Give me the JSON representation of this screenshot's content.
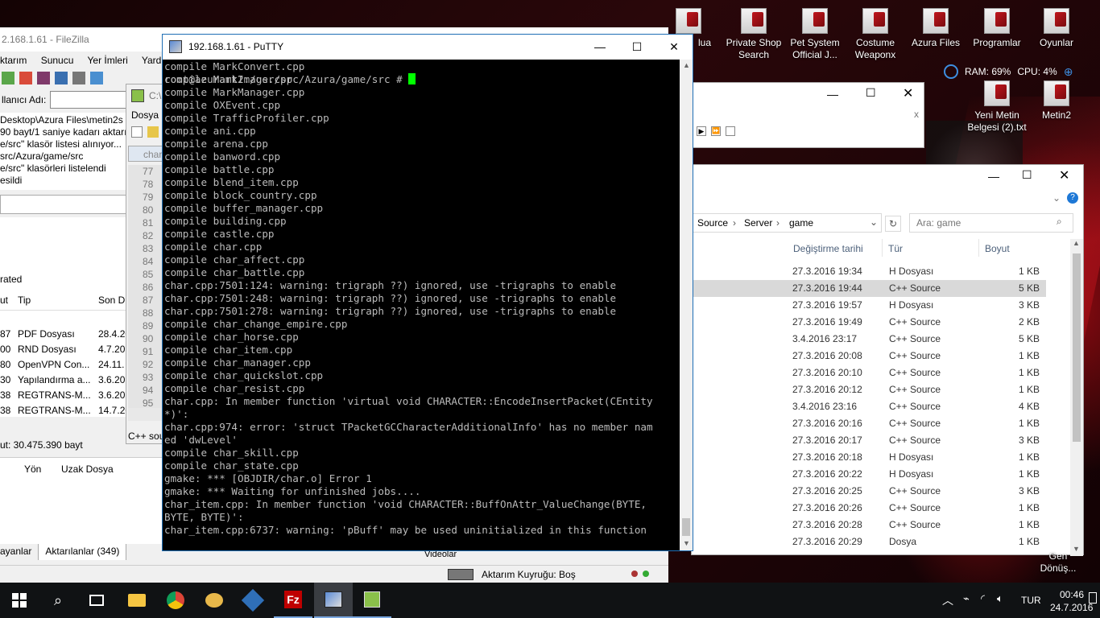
{
  "desktop_icons": [
    {
      "label": "Private Shop Search"
    },
    {
      "label": "Pet System Official J..."
    },
    {
      "label": "Costume Weaponx"
    },
    {
      "label": "Azura Files"
    },
    {
      "label": "Programlar"
    },
    {
      "label": "Oyunlar"
    },
    {
      "label": "Yeni Metin Belgesi (2).txt"
    },
    {
      "label": "Metin2"
    },
    {
      "label": "lua"
    }
  ],
  "resource_meter": {
    "ram": "RAM: 69%",
    "cpu": "CPU: 4%"
  },
  "filezilla": {
    "title": "2.168.1.61 - FileZilla",
    "menu": [
      "ktarım",
      "Sunucu",
      "Yer İmleri",
      "Yardım"
    ],
    "username_label": "llanıcı Adı:",
    "log": [
      "Desktop\\Azura Files\\metin2s",
      "90 bayt/1 saniye kadarı aktarıld",
      "e/src\" klasör listesi alınıyor...",
      "src/Azura/game/src",
      "e/src\" klasörleri listelendi",
      "esildi"
    ],
    "section_label": "rated",
    "columns": [
      "ut",
      "Tip",
      "Son D"
    ],
    "files": [
      {
        "size": "87",
        "type": "PDF Dosyası",
        "date": "28.4.20"
      },
      {
        "size": "00",
        "type": "RND Dosyası",
        "date": "4.7.20"
      },
      {
        "size": "80",
        "type": "OpenVPN Con...",
        "date": "24.11."
      },
      {
        "size": "30",
        "type": "Yapılandırma a...",
        "date": "3.6.20"
      },
      {
        "size": "38",
        "type": "REGTRANS-M...",
        "date": "3.6.20"
      },
      {
        "size": "38",
        "type": "REGTRANS-M...",
        "date": "14.7.20"
      }
    ],
    "total": "ut: 30.475.390 bayt",
    "queue_columns": [
      "Yön",
      "Uzak Dosya"
    ],
    "tabs": [
      "ayanlar",
      "Aktarılanlar (349)"
    ],
    "queue_status": "Aktarım Kuyruğu: Boş"
  },
  "notepad": {
    "title": "C:\\",
    "menu": "Dosya",
    "tab": "char",
    "line_numbers": [
      "77",
      "78",
      "79",
      "80",
      "81",
      "82",
      "83",
      "84",
      "85",
      "86",
      "87",
      "88",
      "89",
      "90",
      "91",
      "92",
      "93",
      "94",
      "95"
    ],
    "status": "C++ sou"
  },
  "explorer": {
    "breadcrumb": [
      "Source",
      "Server",
      "game"
    ],
    "search_placeholder": "Ara: game",
    "columns": [
      "Değiştirme tarihi",
      "Tür",
      "Boyut"
    ],
    "rows": [
      {
        "date": "27.3.2016 19:34",
        "type": "H Dosyası",
        "size": "1 KB"
      },
      {
        "date": "27.3.2016 19:44",
        "type": "C++ Source",
        "size": "5 KB"
      },
      {
        "date": "27.3.2016 19:57",
        "type": "H Dosyası",
        "size": "3 KB"
      },
      {
        "date": "27.3.2016 19:49",
        "type": "C++ Source",
        "size": "2 KB"
      },
      {
        "date": "3.4.2016 23:17",
        "type": "C++ Source",
        "size": "5 KB"
      },
      {
        "date": "27.3.2016 20:08",
        "type": "C++ Source",
        "size": "1 KB"
      },
      {
        "date": "27.3.2016 20:10",
        "type": "C++ Source",
        "size": "1 KB"
      },
      {
        "date": "27.3.2016 20:12",
        "type": "C++ Source",
        "size": "1 KB"
      },
      {
        "date": "3.4.2016 23:16",
        "type": "C++ Source",
        "size": "4 KB"
      },
      {
        "date": "27.3.2016 20:16",
        "type": "C++ Source",
        "size": "1 KB"
      },
      {
        "date": "27.3.2016 20:17",
        "type": "C++ Source",
        "size": "3 KB"
      },
      {
        "date": "27.3.2016 20:18",
        "type": "H Dosyası",
        "size": "1 KB"
      },
      {
        "date": "27.3.2016 20:22",
        "type": "H Dosyası",
        "size": "1 KB"
      },
      {
        "date": "27.3.2016 20:25",
        "type": "C++ Source",
        "size": "3 KB"
      },
      {
        "date": "27.3.2016 20:26",
        "type": "C++ Source",
        "size": "1 KB"
      },
      {
        "date": "27.3.2016 20:28",
        "type": "C++ Source",
        "size": "1 KB"
      },
      {
        "date": "27.3.2016 20:29",
        "type": "Dosya",
        "size": "1 KB"
      }
    ],
    "bottom_label": "Videolar"
  },
  "putty": {
    "title": "192.168.1.61 - PuTTY",
    "lines": [
      "compile MarkConvert.cpp",
      "compile MarkImage.cpp",
      "compile MarkManager.cpp",
      "compile OXEvent.cpp",
      "compile TrafficProfiler.cpp",
      "compile ani.cpp",
      "compile arena.cpp",
      "compile banword.cpp",
      "compile battle.cpp",
      "compile blend_item.cpp",
      "compile block_country.cpp",
      "compile buffer_manager.cpp",
      "compile building.cpp",
      "compile castle.cpp",
      "compile char.cpp",
      "compile char_affect.cpp",
      "compile char_battle.cpp",
      "char.cpp:7501:124: warning: trigraph ??) ignored, use -trigraphs to enable",
      "char.cpp:7501:248: warning: trigraph ??) ignored, use -trigraphs to enable",
      "char.cpp:7501:278: warning: trigraph ??) ignored, use -trigraphs to enable",
      "compile char_change_empire.cpp",
      "compile char_horse.cpp",
      "compile char_item.cpp",
      "compile char_manager.cpp",
      "compile char_quickslot.cpp",
      "compile char_resist.cpp",
      "char.cpp: In member function 'virtual void CHARACTER::EncodeInsertPacket(CEntity",
      "*)':",
      "char.cpp:974: error: 'struct TPacketGCCharacterAdditionalInfo' has no member nam",
      "ed 'dwLevel'",
      "compile char_skill.cpp",
      "compile char_state.cpp",
      "gmake: *** [OBJDIR/char.o] Error 1",
      "gmake: *** Waiting for unfinished jobs....",
      "char_item.cpp: In member function 'void CHARACTER::BuffOnAttr_ValueChange(BYTE,",
      "BYTE, BYTE)':",
      "char_item.cpp:6737: warning: 'pBuff' may be used uninitialized in this function"
    ],
    "prompt": "root@azuramt2:/usr/src/Azura/game/src # "
  },
  "taskbar": {
    "items": [
      "start-icon",
      "search-icon",
      "task-view-icon",
      "file-explorer-icon",
      "chrome-icon",
      "hamster-icon",
      "virtualbox-icon",
      "filezilla-icon",
      "putty-icon",
      "notepad-plus-icon"
    ],
    "language": "TUR",
    "time": "00:46",
    "date": "24.7.2016",
    "partial_right_label": "Gen Dönüş..."
  },
  "colors": {
    "terminal_bg": "#000000",
    "terminal_fg": "#bbbbbb",
    "cursor": "#00ff00",
    "taskbar": "#101214",
    "accent": "#1f6fb5"
  }
}
